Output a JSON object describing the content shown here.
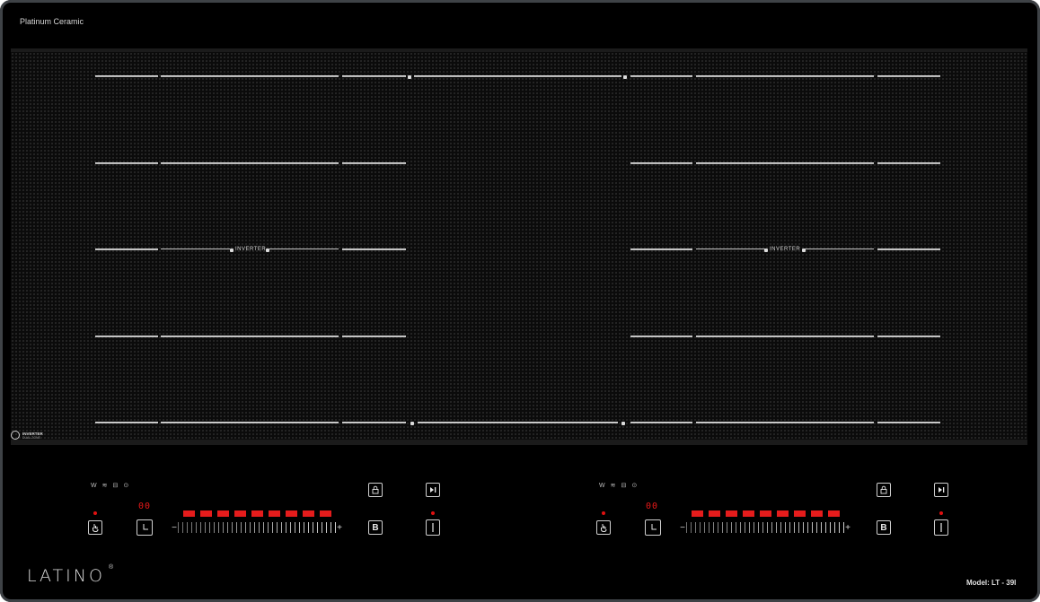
{
  "brand_top": "Platinum Ceramic",
  "zones": {
    "inverter_label": "INVERTER"
  },
  "inverter_badge": {
    "line1": "INVERTER",
    "line2": "DUAL ZONE"
  },
  "controls": [
    {
      "icons": {
        "w": "W",
        "heat": "heat-waves-icon",
        "pot": "pot-icon",
        "keep_warm": "keep-warm-icon"
      },
      "timer_display": "00",
      "power_level_segments": 9,
      "slider_minus": "−",
      "slider_plus": "+",
      "boost_label": "B",
      "lock_icon": "lock-icon",
      "pause_icon": "play-pause-icon",
      "power_icon": "power-icon",
      "select_icon": "hand-select-icon",
      "timer_icon": "clock-icon"
    },
    {
      "icons": {
        "w": "W",
        "heat": "heat-waves-icon",
        "pot": "pot-icon",
        "keep_warm": "keep-warm-icon"
      },
      "timer_display": "00",
      "power_level_segments": 9,
      "slider_minus": "−",
      "slider_plus": "+",
      "boost_label": "B",
      "lock_icon": "lock-icon",
      "pause_icon": "play-pause-icon",
      "power_icon": "power-icon",
      "select_icon": "hand-select-icon",
      "timer_icon": "clock-icon"
    }
  ],
  "logo": "LATINO",
  "logo_mark": "®",
  "model": "Model: LT - 39I",
  "colors": {
    "accent_red": "#e51c1c",
    "body": "#000000",
    "frame": "#3e4246"
  }
}
